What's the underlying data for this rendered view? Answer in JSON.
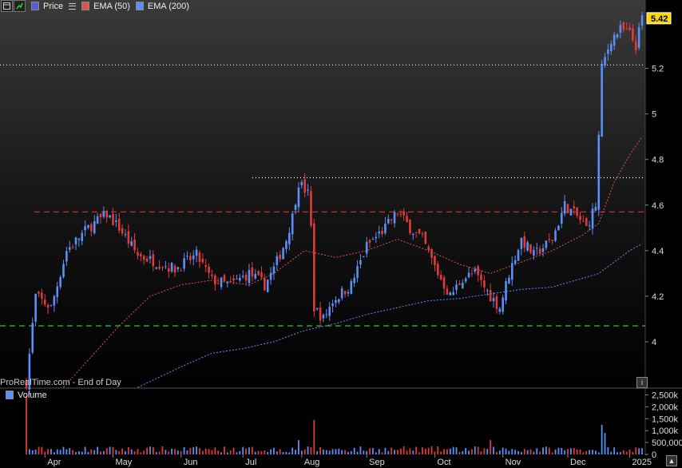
{
  "toolbar": {
    "price_label": "Price",
    "ema50_label": "EMA (50)",
    "ema200_label": "EMA (200)"
  },
  "footnote": "ProRealTime.com - End of Day",
  "volume_label": "Volume",
  "current_price_label": "5.42",
  "colors": {
    "up": "#5b8ff9",
    "down": "#e03a3a",
    "ema50": "#e05050",
    "ema200": "#5b8ff9",
    "background": "#000000",
    "resistance_line": "#e03030",
    "support_line": "#30c030",
    "level_line": "#ffffff",
    "price_box": "#ffd700"
  },
  "chart_data": {
    "type": "candlestick",
    "x_months": [
      "Apr",
      "May",
      "Jun",
      "Jul",
      "Aug",
      "Sep",
      "Oct",
      "Nov",
      "Dec",
      "2025"
    ],
    "price_axis": {
      "ticks": [
        "4",
        "4.2",
        "4.4",
        "4.6",
        "4.8",
        "5",
        "5.2"
      ],
      "range": [
        3.8,
        5.5
      ]
    },
    "volume_axis": {
      "ticks": [
        "2,500k",
        "2,000k",
        "1,500k",
        "1,000k",
        "500,000",
        "0"
      ],
      "range": [
        0,
        2750000
      ]
    },
    "horizontal_levels": [
      {
        "value": 5.215,
        "style": "dotted",
        "color": "white"
      },
      {
        "value": 4.72,
        "style": "dotted",
        "color": "white"
      },
      {
        "value": 4.57,
        "style": "dashed",
        "color": "red"
      },
      {
        "value": 4.07,
        "style": "dashed",
        "color": "green"
      }
    ],
    "last_price": 5.42,
    "price_path": [
      [
        0,
        3.82
      ],
      [
        3,
        4.2
      ],
      [
        8,
        4.15
      ],
      [
        13,
        4.4
      ],
      [
        20,
        4.5
      ],
      [
        26,
        4.56
      ],
      [
        30,
        4.5
      ],
      [
        36,
        4.38
      ],
      [
        42,
        4.35
      ],
      [
        48,
        4.32
      ],
      [
        55,
        4.38
      ],
      [
        60,
        4.27
      ],
      [
        66,
        4.25
      ],
      [
        72,
        4.3
      ],
      [
        77,
        4.25
      ],
      [
        80,
        4.32
      ],
      [
        84,
        4.45
      ],
      [
        86,
        4.55
      ],
      [
        88,
        4.7
      ],
      [
        91,
        4.65
      ],
      [
        92,
        4.5
      ],
      [
        93,
        4.15
      ],
      [
        96,
        4.1
      ],
      [
        99,
        4.18
      ],
      [
        105,
        4.25
      ],
      [
        110,
        4.42
      ],
      [
        116,
        4.5
      ],
      [
        120,
        4.57
      ],
      [
        124,
        4.5
      ],
      [
        128,
        4.45
      ],
      [
        133,
        4.3
      ],
      [
        137,
        4.2
      ],
      [
        141,
        4.28
      ],
      [
        145,
        4.3
      ],
      [
        150,
        4.2
      ],
      [
        153,
        4.15
      ],
      [
        156,
        4.3
      ],
      [
        160,
        4.45
      ],
      [
        164,
        4.38
      ],
      [
        170,
        4.45
      ],
      [
        174,
        4.6
      ],
      [
        178,
        4.55
      ],
      [
        181,
        4.5
      ],
      [
        184,
        4.6
      ],
      [
        186,
        5.2
      ],
      [
        189,
        5.33
      ],
      [
        192,
        5.37
      ],
      [
        195,
        5.35
      ],
      [
        197,
        5.3
      ],
      [
        199,
        5.42
      ]
    ],
    "ema50_path": [
      [
        12,
        3.8
      ],
      [
        30,
        4.07
      ],
      [
        40,
        4.2
      ],
      [
        50,
        4.25
      ],
      [
        60,
        4.27
      ],
      [
        72,
        4.25
      ],
      [
        80,
        4.3
      ],
      [
        90,
        4.4
      ],
      [
        100,
        4.37
      ],
      [
        110,
        4.4
      ],
      [
        120,
        4.45
      ],
      [
        130,
        4.4
      ],
      [
        140,
        4.34
      ],
      [
        150,
        4.3
      ],
      [
        160,
        4.35
      ],
      [
        170,
        4.4
      ],
      [
        180,
        4.47
      ],
      [
        185,
        4.52
      ],
      [
        190,
        4.7
      ],
      [
        195,
        4.82
      ],
      [
        199,
        4.9
      ]
    ],
    "ema200_path": [
      [
        36,
        3.8
      ],
      [
        50,
        3.89
      ],
      [
        60,
        3.95
      ],
      [
        70,
        3.97
      ],
      [
        80,
        4.0
      ],
      [
        90,
        4.05
      ],
      [
        100,
        4.08
      ],
      [
        110,
        4.12
      ],
      [
        120,
        4.15
      ],
      [
        130,
        4.18
      ],
      [
        140,
        4.19
      ],
      [
        150,
        4.21
      ],
      [
        160,
        4.23
      ],
      [
        170,
        4.24
      ],
      [
        180,
        4.28
      ],
      [
        185,
        4.3
      ],
      [
        190,
        4.35
      ],
      [
        195,
        4.4
      ],
      [
        199,
        4.43
      ]
    ]
  }
}
